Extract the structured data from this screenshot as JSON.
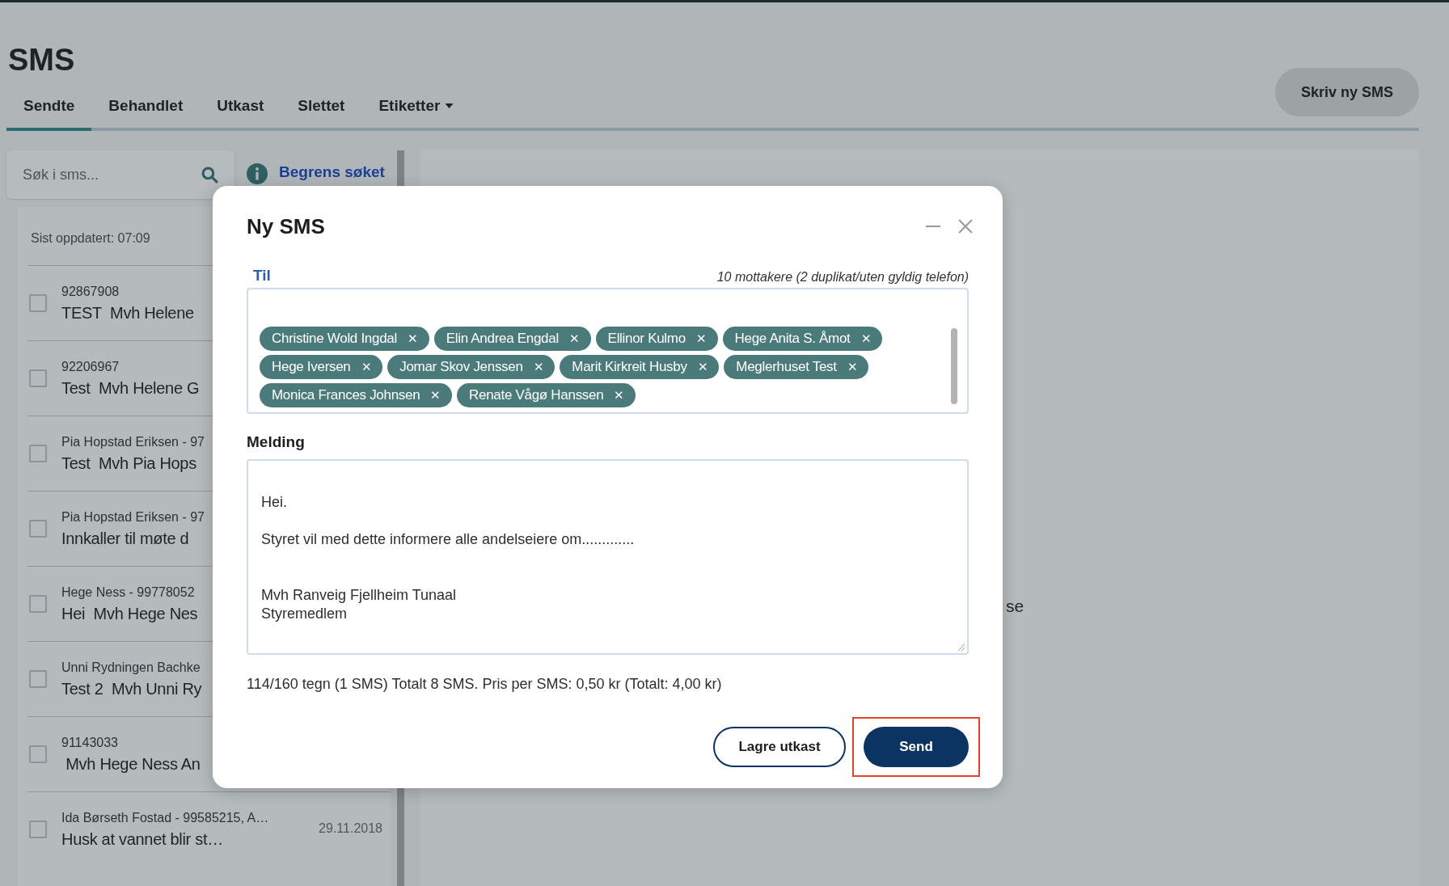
{
  "page": {
    "title": "SMS",
    "new_button": "Skriv ny SMS"
  },
  "tabs": [
    {
      "label": "Sendte",
      "selected": true,
      "dropdown": false
    },
    {
      "label": "Behandlet",
      "selected": false,
      "dropdown": false
    },
    {
      "label": "Utkast",
      "selected": false,
      "dropdown": false
    },
    {
      "label": "Slettet",
      "selected": false,
      "dropdown": false
    },
    {
      "label": "Etiketter",
      "selected": false,
      "dropdown": true
    }
  ],
  "search": {
    "placeholder": "Søk i sms..."
  },
  "filter_link": "Begrens søket",
  "list": {
    "updated": "Sist oppdatert: 07:09",
    "items": [
      {
        "recipient": "92867908",
        "message": "TEST  Mvh Helene",
        "checked": false
      },
      {
        "recipient": "92206967",
        "message": "Test  Mvh Helene G",
        "checked": false
      },
      {
        "recipient": "Pia Hopstad Eriksen - 97",
        "message": "Test  Mvh Pia Hops",
        "checked": false
      },
      {
        "recipient": "Pia Hopstad Eriksen - 97",
        "message": "Innkaller til møte d",
        "checked": false
      },
      {
        "recipient": "Hege Ness - 99778052",
        "message": "Hei  Mvh Hege Nes",
        "checked": false
      },
      {
        "recipient": "Unni Rydningen Bachke",
        "message": "Test 2  Mvh Unni Ry",
        "checked": false
      },
      {
        "recipient": "91143033",
        "message": " Mvh Hege Ness An",
        "checked": false
      },
      {
        "recipient": "Ida Børseth Fostad - 99585215, A…",
        "message": "Husk at vannet blir st…",
        "date": "29.11.2018",
        "checked": false
      }
    ]
  },
  "main_text_fragment": "se",
  "dialog": {
    "title": "Ny SMS",
    "to_label": "Til",
    "recipients_note": "10 mottakere (2 duplikat/uten gyldig telefon)",
    "recipients": [
      "Christine Wold Ingdal",
      "Elin Andrea Engdal",
      "Ellinor Kulmo",
      "Hege Anita S. Åmot",
      "Hege Iversen",
      "Jomar Skov Jenssen",
      "Marit Kirkreit Husby",
      "Meglerhuset Test",
      "Monica Frances Johnsen",
      "Renate Vågø Hanssen"
    ],
    "chip_remove": "✕",
    "message_label": "Melding",
    "message": [
      "Hei.",
      "Styret vil med dette informere alle andelseiere om.............",
      "Mvh Ranveig Fjellheim Tunaal\nStyremedlem"
    ],
    "counter": "114/160 tegn (1 SMS) Totalt 8 SMS. Pris per SMS: 0,50 kr (Totalt: 4,00 kr)",
    "save_button": "Lagre utkast",
    "send_button": "Send",
    "send_highlighted": true
  }
}
